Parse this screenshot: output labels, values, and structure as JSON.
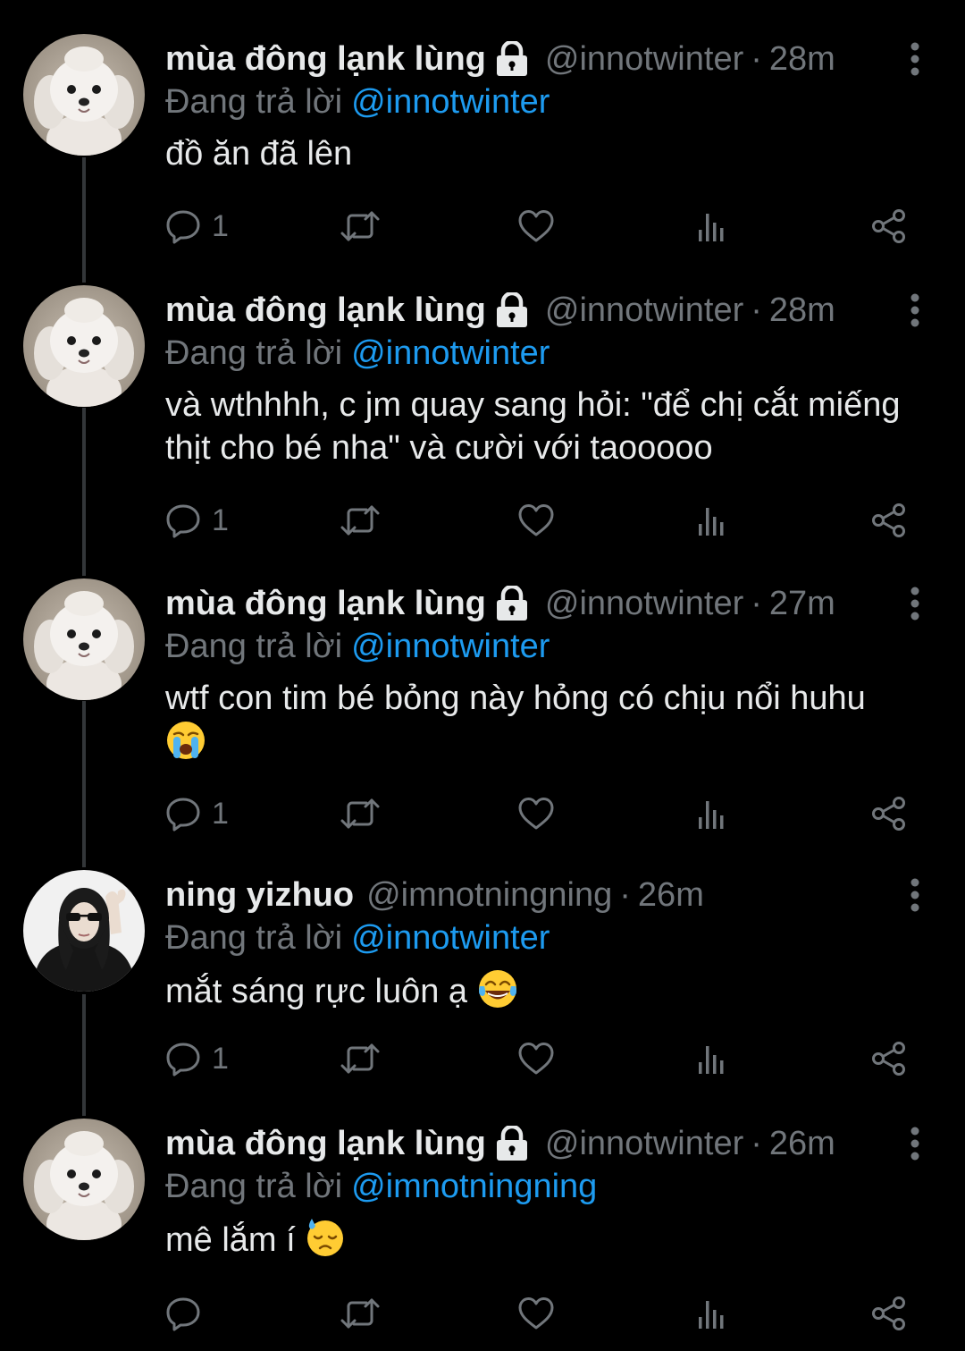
{
  "colors": {
    "background": "#000000",
    "text": "#e7e9ea",
    "secondary": "#71767b",
    "accent": "#1d9bf0",
    "thread_line": "#333639"
  },
  "tweets": [
    {
      "name": "mùa đông lạnk lùng",
      "protected": true,
      "avatar": "dog-avatar",
      "handle": "@innotwinter",
      "separator": "·",
      "time": "28m",
      "reply_prefix": "Đang trả lời",
      "reply_to": "@innotwinter",
      "text": "đồ ăn đã lên",
      "emoji": "",
      "reply_count": "1"
    },
    {
      "name": "mùa đông lạnk lùng",
      "protected": true,
      "avatar": "dog-avatar",
      "handle": "@innotwinter",
      "separator": "·",
      "time": "28m",
      "reply_prefix": "Đang trả lời",
      "reply_to": "@innotwinter",
      "text": "và wthhhh, c jm quay sang hỏi: \"để chị cắt miếng thịt cho bé nha\" và cười với taooooo",
      "emoji": "",
      "reply_count": "1"
    },
    {
      "name": "mùa đông lạnk lùng",
      "protected": true,
      "avatar": "dog-avatar",
      "handle": "@innotwinter",
      "separator": "·",
      "time": "27m",
      "reply_prefix": "Đang trả lời",
      "reply_to": "@innotwinter",
      "text": "wtf con tim bé bỏng này hỏng có chịu nổi huhu",
      "emoji": "crying-face",
      "reply_count": "1"
    },
    {
      "name": "ning yizhuo",
      "protected": false,
      "avatar": "girl-avatar",
      "handle": "@imnotningning",
      "separator": "·",
      "time": "26m",
      "reply_prefix": "Đang trả lời",
      "reply_to": "@innotwinter",
      "text": "mắt sáng rực luôn ạ",
      "emoji": "tears-of-joy",
      "reply_count": "1"
    },
    {
      "name": "mùa đông lạnk lùng",
      "protected": true,
      "avatar": "dog-avatar",
      "handle": "@innotwinter",
      "separator": "·",
      "time": "26m",
      "reply_prefix": "Đang trả lời",
      "reply_to": "@imnotningning",
      "text": "mê lắm í",
      "emoji": "downcast-sweat",
      "reply_count": ""
    }
  ]
}
